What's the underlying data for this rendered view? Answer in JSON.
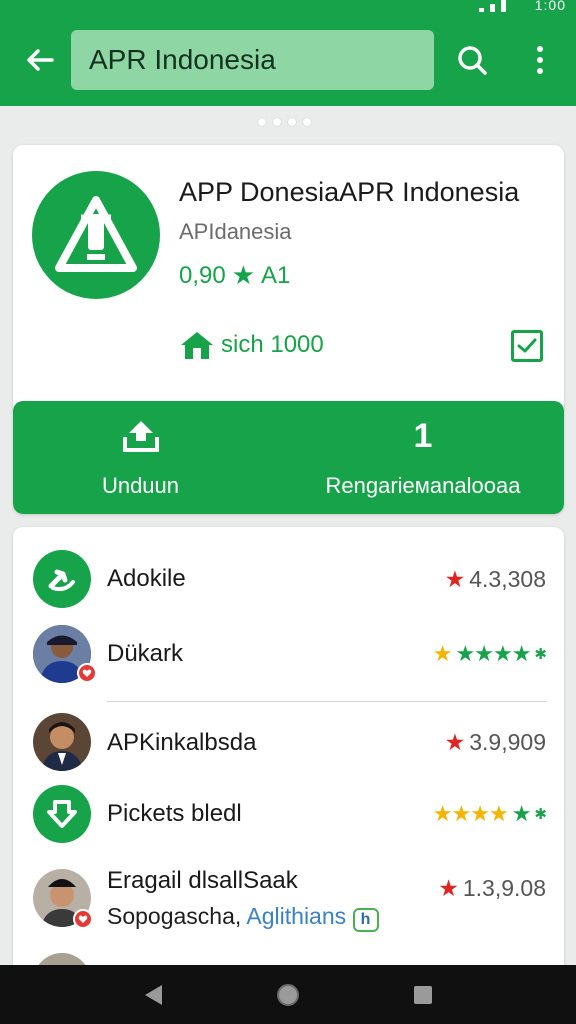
{
  "status_bar": {
    "time": "1:00"
  },
  "search": {
    "query": "APR Indonesia"
  },
  "app": {
    "title": "APP DonesiaAPR Indonesia",
    "developer": "APIdanesia",
    "rating_value": "0,90",
    "rating_count": "A1",
    "installs": "sich 1000"
  },
  "actions": {
    "left_label": "Unduun",
    "right_number": "1",
    "right_label": "Rengarieмаnalooaa"
  },
  "list": [
    {
      "name": "Adokile",
      "score": "4.3,308",
      "score_type": "number",
      "avatar": "green-arrow"
    },
    {
      "name": "Dükark",
      "score": "★★★★★",
      "score_type": "stars-yellow-green",
      "avatar": "photo-badge"
    },
    {
      "name": "APKinkalbsda",
      "score": "3.9,909",
      "score_type": "number",
      "avatar": "photo"
    },
    {
      "name": "Pickets bledl",
      "score": "★★★★★",
      "score_type": "stars-yellow-green",
      "avatar": "green-down"
    },
    {
      "name": "Eragail dlsallSaak",
      "score": "1.3,9.08",
      "score_type": "number",
      "avatar": "photo-badge",
      "sub": "Sopogascha,",
      "sub_link": "Aglithians",
      "sub_badge": "h"
    }
  ],
  "colors": {
    "primary": "#16a34a",
    "search_bg": "#8fd6a5",
    "red_star": "#e02424",
    "yellow_star": "#f4b400"
  }
}
